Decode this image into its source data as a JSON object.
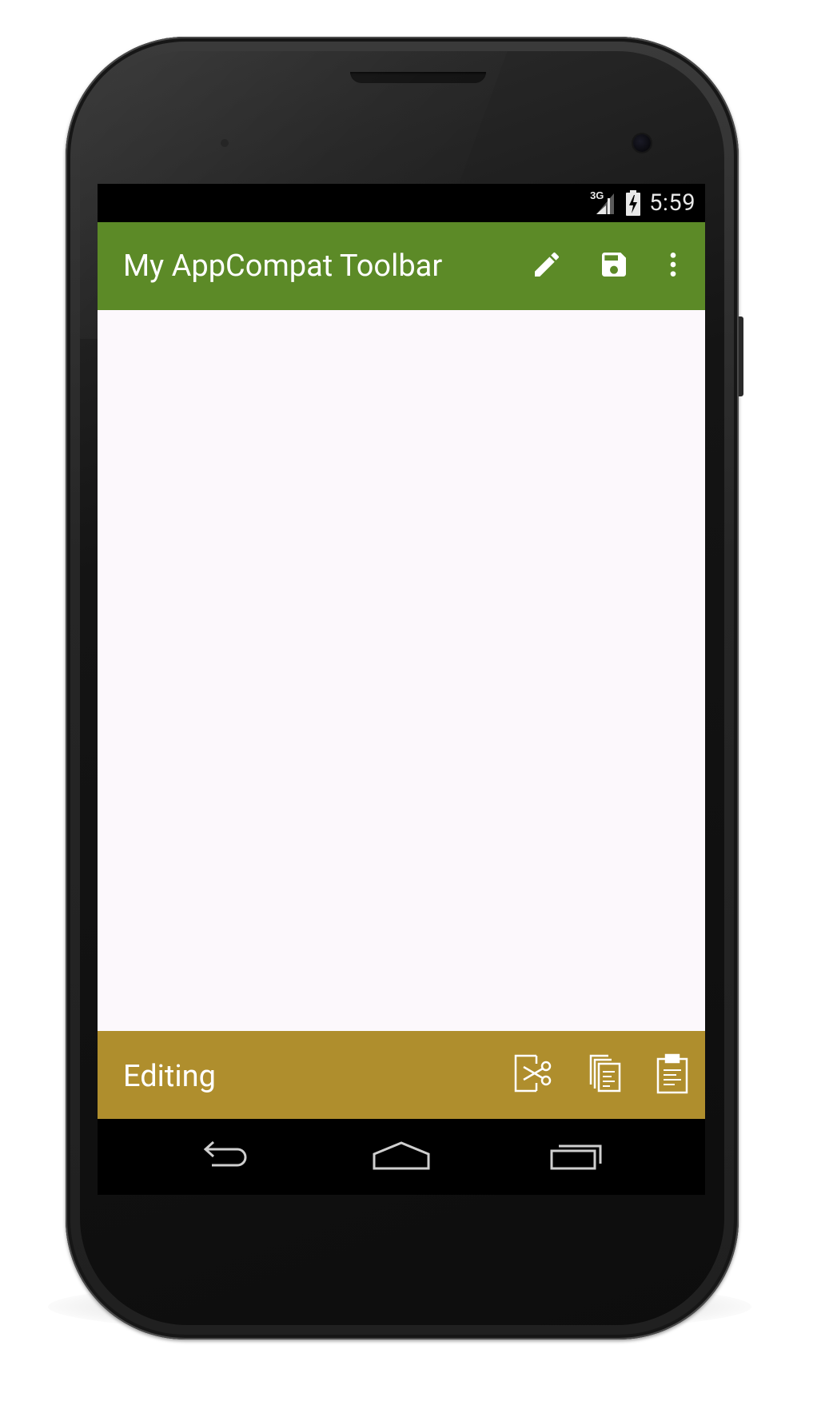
{
  "status_bar": {
    "network": "3G",
    "time": "5:59"
  },
  "top_toolbar": {
    "title": "My AppCompat Toolbar",
    "background_color": "#5c8a27",
    "actions": [
      {
        "icon": "edit-pencil-icon"
      },
      {
        "icon": "save-floppy-icon"
      },
      {
        "icon": "overflow-menu-icon"
      }
    ]
  },
  "content": {
    "background_color": "#fcf8fc"
  },
  "bottom_toolbar": {
    "title": "Editing",
    "background_color": "#af8e2d",
    "actions": [
      {
        "icon": "cut-scissors-icon"
      },
      {
        "icon": "copy-icon"
      },
      {
        "icon": "paste-clipboard-icon"
      }
    ]
  },
  "nav_bar": {
    "buttons": [
      {
        "icon": "back-arrow-icon"
      },
      {
        "icon": "home-icon"
      },
      {
        "icon": "recent-apps-icon"
      }
    ]
  }
}
